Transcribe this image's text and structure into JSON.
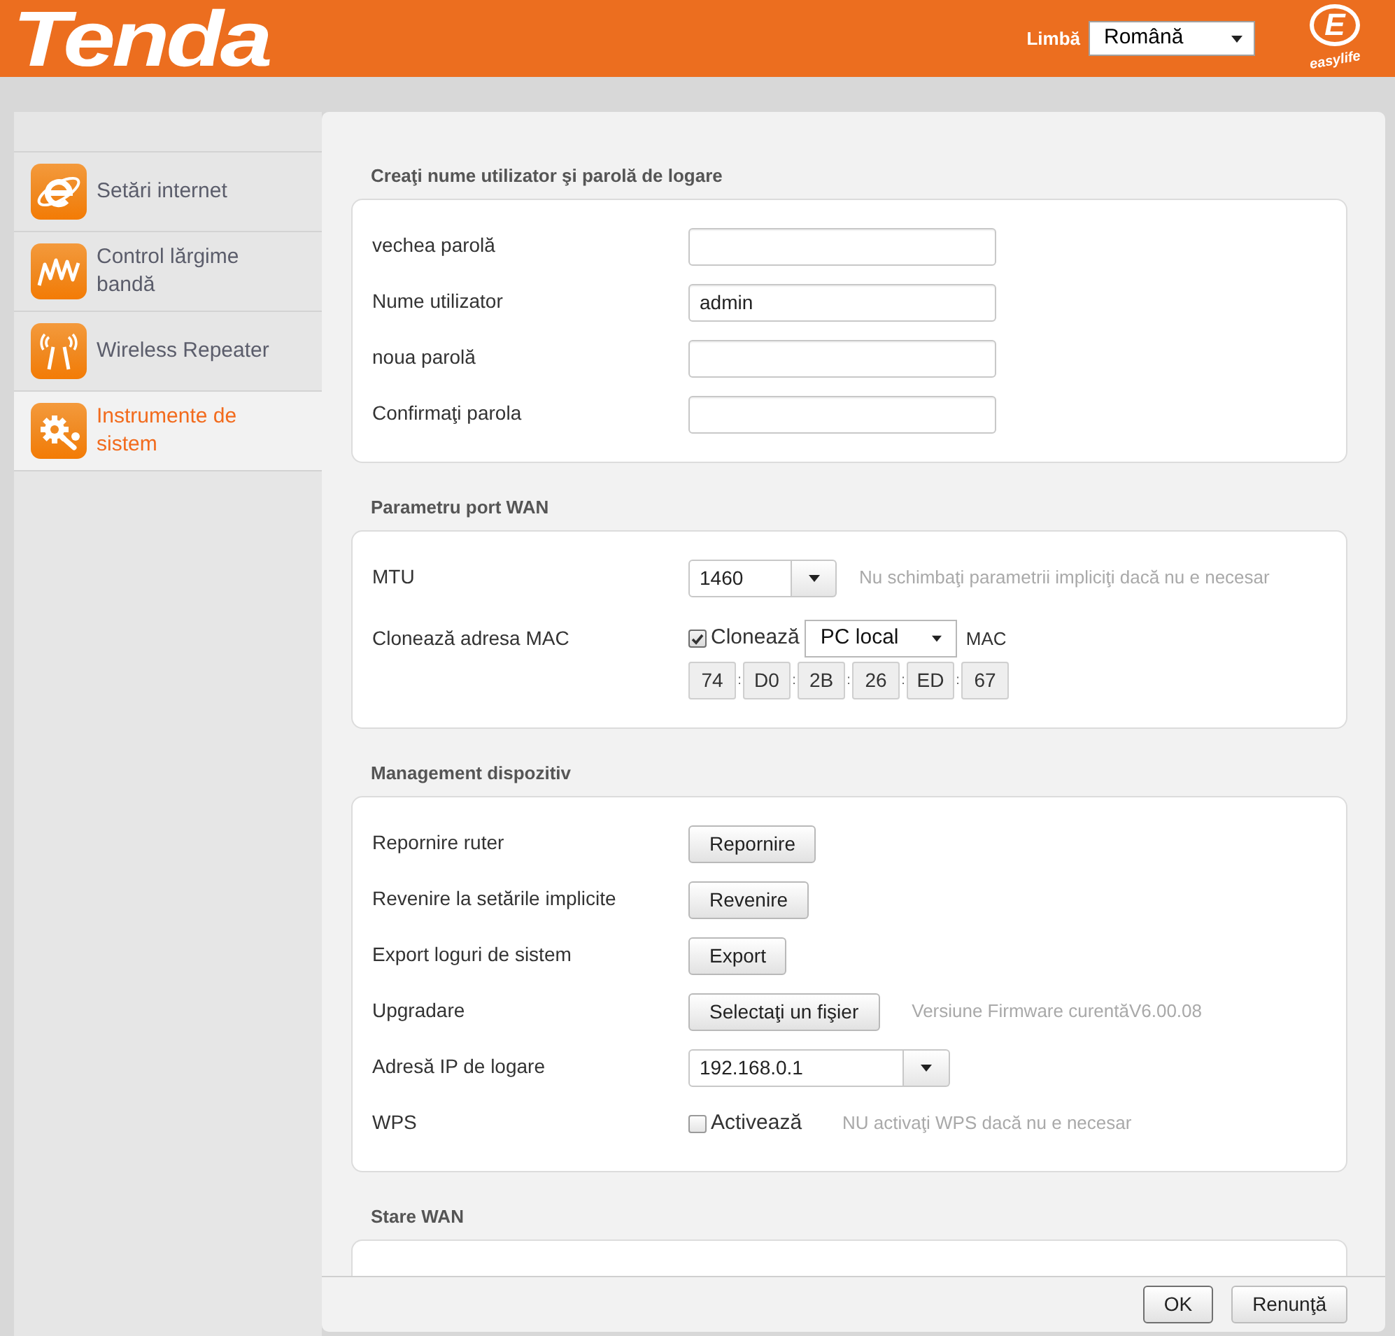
{
  "header": {
    "logo": "Tenda",
    "language_label": "Limbă",
    "language": "Română",
    "badge": {
      "letter": "E",
      "tagline": "easylife"
    }
  },
  "sidebar": {
    "items": [
      {
        "label": "Setări internet",
        "selected": false
      },
      {
        "label": "Control lărgime bandă",
        "selected": false
      },
      {
        "label": "Wireless Repeater",
        "selected": false
      },
      {
        "label": "Instrumente de sistem",
        "selected": true
      }
    ]
  },
  "sections": [
    {
      "title": "Creaţi nume utilizator şi parolă de logare",
      "rows": [
        {
          "kind": "text",
          "label": "vechea parolă"
        },
        {
          "kind": "text",
          "label": "Nume utilizator",
          "value": "admin"
        },
        {
          "kind": "text",
          "label": "noua parolă"
        },
        {
          "kind": "text",
          "label": "Confirmaţi parola"
        }
      ]
    },
    {
      "title": "Parametru port WAN",
      "rows": [
        {
          "kind": "number_combo",
          "label": "MTU",
          "value": "1460",
          "hint": "Nu schimbaţi parametrii impliciţi dacă nu e necesar"
        },
        {
          "kind": "mac_clone",
          "label": "Clonează adresa MAC",
          "checkbox": {
            "label": "Clonează",
            "checked": true
          },
          "select": "PC local",
          "suffix": "MAC",
          "mac": [
            {
              "kind": "octet",
              "text": "74"
            },
            {
              "kind": "separator",
              "text": ":"
            },
            {
              "kind": "octet",
              "text": "D0"
            },
            {
              "kind": "separator",
              "text": ":"
            },
            {
              "kind": "octet",
              "text": "2B"
            },
            {
              "kind": "separator",
              "text": ":"
            },
            {
              "kind": "octet",
              "text": "26"
            },
            {
              "kind": "separator",
              "text": ":"
            },
            {
              "kind": "octet",
              "text": "ED"
            },
            {
              "kind": "separator",
              "text": ":"
            },
            {
              "kind": "octet",
              "text": "67"
            }
          ]
        }
      ]
    },
    {
      "title": "Management dispozitiv",
      "rows": [
        {
          "kind": "button",
          "label": "Repornire ruter",
          "button": "Repornire"
        },
        {
          "kind": "button",
          "label": "Revenire la setările implicite",
          "button": "Revenire"
        },
        {
          "kind": "button",
          "label": "Export loguri de sistem",
          "button": "Export"
        },
        {
          "kind": "button",
          "label": "Upgradare",
          "button": "Selectaţi un fişier",
          "hint": "Versiune Firmware curentăV6.00.08"
        },
        {
          "kind": "ip_combo",
          "label": "Adresă IP de logare",
          "value": "192.168.0.1"
        },
        {
          "kind": "checkbox",
          "label": "WPS",
          "checkbox": {
            "label": "Activează",
            "checked": false
          },
          "hint": "NU activaţi WPS dacă nu e necesar"
        }
      ]
    },
    {
      "title": "Stare WAN"
    }
  ],
  "footer": {
    "buttons": [
      {
        "label": "OK",
        "focused": true
      },
      {
        "label": "Renunţă",
        "focused": false
      }
    ]
  }
}
